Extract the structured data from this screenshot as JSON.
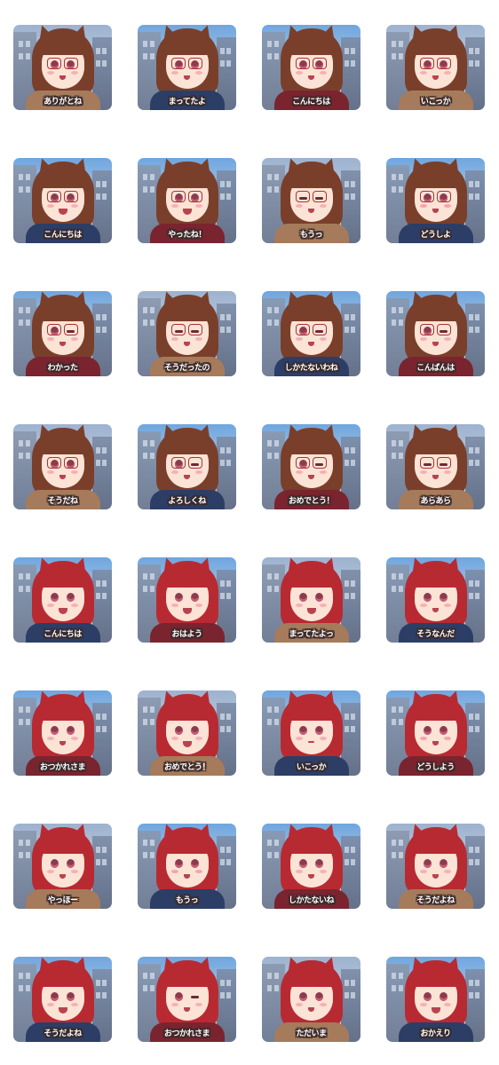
{
  "colors": {
    "page_background": "#ffffff",
    "label_text": "#ffffff",
    "label_outline": "#3a2a2a",
    "brown_hair": "#7a3f2a",
    "red_hair": "#b82a32",
    "glasses_frame": "#a5362f",
    "skin": "#fbe3d6",
    "sky_day": "#6fa6df",
    "sky_evening": "#9db2cf",
    "scarf_brown": "#a67b5b",
    "scarf_navy": "#2c3e66",
    "scarf_red": "#7a2430"
  },
  "stickers": [
    {
      "label": "ありがとね",
      "character": "brown-haired girl with glasses",
      "expression": "smile"
    },
    {
      "label": "まってたよ",
      "character": "brown-haired girl with glasses",
      "expression": "smile"
    },
    {
      "label": "こんにちは",
      "character": "brown-haired girl with glasses",
      "expression": "smile"
    },
    {
      "label": "いこっか",
      "character": "brown-haired girl with glasses",
      "expression": "smile"
    },
    {
      "label": "こんにちは",
      "character": "brown-haired girl with glasses",
      "expression": "open smile"
    },
    {
      "label": "やったね！",
      "character": "brown-haired girl with glasses",
      "expression": "open smile"
    },
    {
      "label": "もうっ",
      "character": "brown-haired girl with glasses",
      "expression": "eyes closed"
    },
    {
      "label": "どうしよ",
      "character": "brown-haired girl with glasses",
      "expression": "blush"
    },
    {
      "label": "わかった",
      "character": "brown-haired girl with glasses",
      "expression": "wink"
    },
    {
      "label": "そうだったの",
      "character": "brown-haired girl with glasses",
      "expression": "eyes closed"
    },
    {
      "label": "しかたないわね",
      "character": "brown-haired girl with glasses",
      "expression": "wink"
    },
    {
      "label": "こんばんは",
      "character": "brown-haired girl with glasses",
      "expression": "wink"
    },
    {
      "label": "そうだね",
      "character": "brown-haired girl with glasses",
      "expression": "smile"
    },
    {
      "label": "よろしくね",
      "character": "brown-haired girl with glasses",
      "expression": "wink"
    },
    {
      "label": "おめでとう！",
      "character": "brown-haired girl with glasses",
      "expression": "wink"
    },
    {
      "label": "あらあら",
      "character": "brown-haired girl with glasses",
      "expression": "eyes closed"
    },
    {
      "label": "こんにちは",
      "character": "red-haired cat-eared girl",
      "expression": "open smile"
    },
    {
      "label": "おはよう",
      "character": "red-haired cat-eared girl",
      "expression": "open smile"
    },
    {
      "label": "まってたよっ",
      "character": "red-haired cat-eared girl",
      "expression": "open smile"
    },
    {
      "label": "そうなんだ",
      "character": "red-haired cat-eared girl",
      "expression": "smile"
    },
    {
      "label": "おつかれさま",
      "character": "red-haired cat-eared girl",
      "expression": "smile"
    },
    {
      "label": "おめでとう！",
      "character": "red-haired cat-eared girl",
      "expression": "open smile"
    },
    {
      "label": "いこっか",
      "character": "red-haired cat-eared girl",
      "expression": "neutral"
    },
    {
      "label": "どうしよう",
      "character": "red-haired cat-eared girl",
      "expression": "blush"
    },
    {
      "label": "やっほー",
      "character": "red-haired cat-eared girl",
      "expression": "smile"
    },
    {
      "label": "もうっ",
      "character": "red-haired cat-eared girl",
      "expression": "blush"
    },
    {
      "label": "しかたないね",
      "character": "red-haired cat-eared girl",
      "expression": "smile"
    },
    {
      "label": "そうだよね",
      "character": "red-haired cat-eared girl",
      "expression": "smile"
    },
    {
      "label": "そうだよね",
      "character": "red-haired cat-eared girl",
      "expression": "open smile"
    },
    {
      "label": "おつかれさま",
      "character": "red-haired cat-eared girl",
      "expression": "wink"
    },
    {
      "label": "ただいま",
      "character": "red-haired cat-eared girl",
      "expression": "smile"
    },
    {
      "label": "おかえり",
      "character": "red-haired cat-eared girl",
      "expression": "open smile"
    }
  ]
}
